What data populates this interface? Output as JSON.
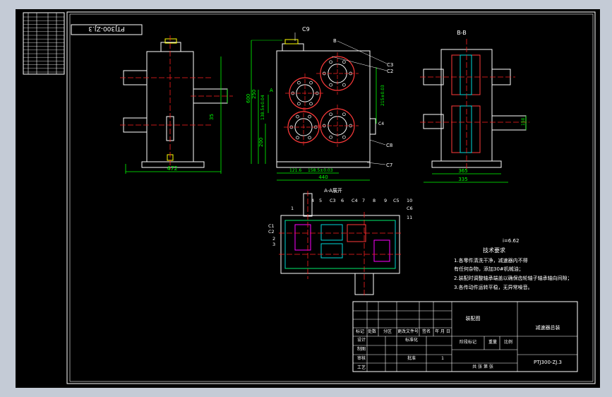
{
  "colors": {
    "viewport_bg": "#c4cbd6",
    "paper": "#000000",
    "line": "#ffffff",
    "dim": "#00ff00",
    "center": "#ff2020",
    "part": "#ff3a3a",
    "hatch": "#00d8d8",
    "yellow": "#ffff00",
    "magenta": "#ff00ff"
  },
  "drawing": {
    "drawing_no_rotated": "PTJ300-ZJ.3",
    "front_dims": {
      "width": "472",
      "height_side": "35"
    },
    "mid_dims": {
      "top_label": "C9",
      "left_height": "600",
      "h1": "250",
      "h2": "200",
      "center_v": "138.5±0.04",
      "center_r": "215±0.03",
      "bottom_width": "440",
      "bottom_a": "121.6",
      "bottom_b": "158.5±0.03",
      "section_mark": "A",
      "callouts": [
        "B",
        "C3",
        "C2",
        "C8",
        "C7",
        "C4"
      ]
    },
    "side_dims": {
      "section_title": "B-B",
      "w1": "365",
      "w2": "335",
      "h": "150"
    },
    "section_title": "A-A展开",
    "section_callouts": [
      "1",
      "4",
      "5",
      "C3",
      "6",
      "C4",
      "7",
      "8",
      "9",
      "C5",
      "10",
      "C6",
      "11",
      "2",
      "3",
      "C2",
      "C1"
    ],
    "ratio": "i=6.62",
    "tech_title": "技术要求",
    "tech_notes": [
      "1.各零件清洗干净，减速器内不得",
      "有任何杂物，添加30#机械油；",
      "2.装配时调整轴承端盖以确保齿轮轴子轴承轴向间隙；",
      "3.各传动件运转平稳，无异常噪音。"
    ]
  },
  "title_block": {
    "assembly_label": "装配图",
    "product_name": "减速器总装",
    "drawing_no": "PTJ300-ZJ.3",
    "rev_headers": [
      "标记",
      "处数",
      "分区",
      "更改文件号",
      "签名",
      "年 月 日"
    ],
    "rows_left": [
      "设计",
      "制图",
      "审核",
      "工艺"
    ],
    "standardize": "标准化",
    "approve": "批准",
    "stage_mark": "阶段标记",
    "weight": "重量",
    "scale": "比例",
    "sheet": "共  张  第  张",
    "count": "1"
  }
}
